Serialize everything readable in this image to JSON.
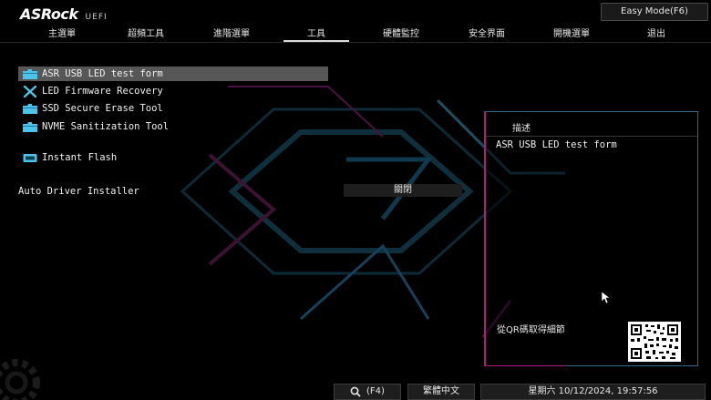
{
  "header": {
    "brand": "ASRock",
    "brand_sub": "UEFI",
    "easy_mode_label": "Easy Mode(F6)"
  },
  "tabs": [
    {
      "label": "主選單",
      "active": false
    },
    {
      "label": "超頻工具",
      "active": false
    },
    {
      "label": "進階選單",
      "active": false
    },
    {
      "label": "工具",
      "active": true
    },
    {
      "label": "硬體監控",
      "active": false
    },
    {
      "label": "安全界面",
      "active": false
    },
    {
      "label": "開機選單",
      "active": false
    },
    {
      "label": "退出",
      "active": false
    }
  ],
  "menu": {
    "items": [
      {
        "label": "ASR USB LED test form",
        "icon": "folder-icon",
        "selected": true
      },
      {
        "label": "LED Firmware Recovery",
        "icon": "tools-icon",
        "selected": false
      },
      {
        "label": "SSD Secure Erase Tool",
        "icon": "folder-icon",
        "selected": false
      },
      {
        "label": "NVME Sanitization Tool",
        "icon": "folder-icon",
        "selected": false
      },
      {
        "label": "Instant Flash",
        "icon": "flash-chip-icon",
        "selected": false
      }
    ],
    "settings": [
      {
        "label": "Auto Driver Installer",
        "value": "關閉"
      }
    ]
  },
  "description": {
    "title": "描述",
    "text": "ASR USB LED test form",
    "qr_label": "從QR碼取得細節"
  },
  "footer": {
    "search_key": "(F4)",
    "language": "繁體中文",
    "datetime": "星期六 10/12/2024, 19:57:56"
  },
  "colors": {
    "accent_magenta": "#b21d7a",
    "accent_cyan": "#2a6f86",
    "selected_bg": "#575757",
    "folder_icon": "#4ec3e8"
  }
}
